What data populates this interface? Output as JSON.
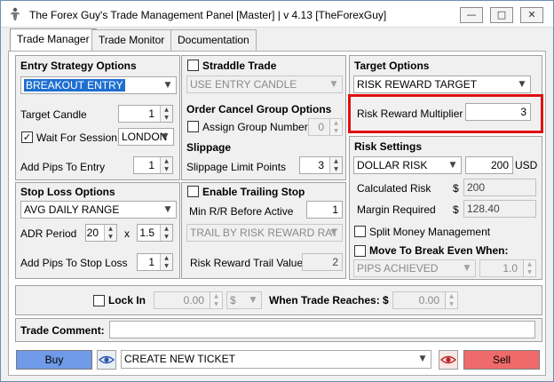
{
  "window": {
    "title": "The Forex Guy's Trade Management Panel [Master] | v 4.13 [TheForexGuy]"
  },
  "tabs": [
    {
      "label": "Trade Manager"
    },
    {
      "label": "Trade Monitor"
    },
    {
      "label": "Documentation"
    }
  ],
  "entry": {
    "title": "Entry Strategy Options",
    "strategy": "BREAKOUT ENTRY",
    "target_candle_label": "Target Candle",
    "target_candle": "1",
    "wait_session_label": "Wait For Session",
    "wait_session_checked": "✓",
    "session": "LONDON",
    "add_pips_label": "Add Pips To Entry",
    "add_pips": "1"
  },
  "straddle": {
    "label": "Straddle Trade",
    "candle": "USE ENTRY CANDLE",
    "oco_title": "Order Cancel Group Options",
    "assign_group_label": "Assign Group Number",
    "group_number": "0",
    "slippage_title": "Slippage",
    "slippage_label": "Slippage Limit Points",
    "slippage": "3"
  },
  "target": {
    "title": "Target Options",
    "type": "RISK REWARD TARGET",
    "multiplier_label": "Risk Reward Multiplier",
    "multiplier": "3"
  },
  "stop": {
    "title": "Stop Loss Options",
    "type": "AVG DAILY RANGE",
    "adr_label": "ADR Period",
    "adr": "20",
    "x_label": "x",
    "adr_mult": "1.5",
    "add_pips_label": "Add Pips To Stop Loss",
    "add_pips": "1"
  },
  "trailing": {
    "label": "Enable Trailing Stop",
    "min_rr_label": "Min R/R Before Active",
    "min_rr": "1",
    "mode": "TRAIL BY RISK REWARD RAT",
    "trail_value_label": "Risk Reward Trail Value",
    "trail_value": "2"
  },
  "risk": {
    "title": "Risk Settings",
    "type": "DOLLAR RISK",
    "amount": "200",
    "currency": "USD",
    "calc_label": "Calculated Risk",
    "calc_symbol": "$",
    "calc_value": "200",
    "margin_label": "Margin Required",
    "margin_symbol": "$",
    "margin_value": "128.40",
    "split_label": "Split Money Management",
    "breakeven_label": "Move To Break Even When:",
    "breakeven_mode": "PIPS ACHIEVED",
    "breakeven_value": "1.0"
  },
  "lockin": {
    "label": "Lock In",
    "amount": "0.00",
    "currency": "$",
    "when_label": "When Trade Reaches: $",
    "reaches": "0.00"
  },
  "comment": {
    "label": "Trade Comment:",
    "value": ""
  },
  "bottom": {
    "buy_label": "Buy",
    "ticket": "CREATE NEW TICKET",
    "sell_label": "Sell"
  },
  "colors": {
    "buy": "#6f9be8",
    "sell": "#ef6a6a",
    "highlight": "#e01010",
    "selection": "#1f6fd1"
  },
  "icons": {
    "app": "figure-icon",
    "eye": "eye-icon"
  }
}
